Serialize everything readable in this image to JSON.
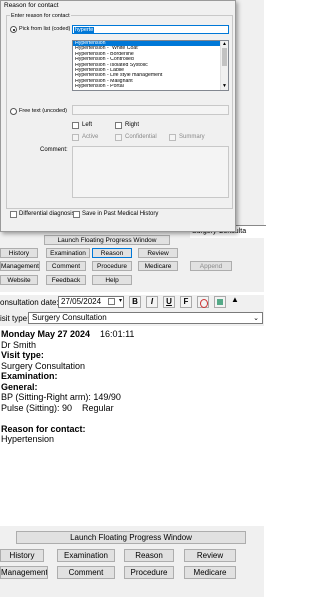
{
  "dialog": {
    "title": "Reason for contact",
    "group_label": "Enter reason for contact",
    "pick_label": "Pick from list (coded)",
    "search_value": "hyperte",
    "list_items": [
      "Hypertension",
      "Hypertension - \"White Coat\"",
      "Hypertension - Borderline",
      "Hypertension - Controlled",
      "Hypertension - Isolated Systolic",
      "Hypertension - Labile",
      "Hypertension - Life style management",
      "Hypertension - Malignant",
      "Hypertension - Portal"
    ],
    "free_text_label": "Free text (uncoded)",
    "left_label": "Left",
    "right_label": "Right",
    "active_label": "Active",
    "confidential_label": "Confidential",
    "summary_label": "Summary",
    "comment_label": "Comment:",
    "differential_label": "Differential diagnosis",
    "save_past_label": "Save in Past Medical History"
  },
  "background_top": {
    "launch_label": "Launch Floating Progress Window",
    "buttons_row1": [
      "History",
      "Examination",
      "Reason",
      "Review"
    ],
    "buttons_row2": [
      "Management",
      "Comment",
      "Procedure",
      "Medicare",
      "Append"
    ],
    "buttons_row3": [
      "Website",
      "Feedback",
      "Help"
    ],
    "visit_type_snippet": "Surgery Consulta"
  },
  "consult": {
    "date_label": "onsultation date:",
    "date_value": "27/05/2024",
    "visit_type_label": "isit type:",
    "visit_type_value": "Surgery Consultation",
    "toolbar": [
      "B",
      "I",
      "U",
      "F"
    ],
    "note_lines": [
      {
        "text": "Monday May 27 2024",
        "extra": "16:01:11",
        "bold": true
      },
      {
        "text": "Dr Smith",
        "bold": false
      },
      {
        "text": "Visit type:",
        "bold": true
      },
      {
        "text": "Surgery Consultation",
        "bold": false
      },
      {
        "text": "Examination:",
        "bold": true
      },
      {
        "text": "General:",
        "bold": true
      },
      {
        "text": "BP (Sitting-Right arm): 149/90",
        "bold": false
      },
      {
        "text": "Pulse (Sitting): 90",
        "extra": "Regular",
        "bold": false
      },
      {
        "text": "",
        "bold": false
      },
      {
        "text": "Reason for contact:",
        "bold": true
      },
      {
        "text": "Hypertension",
        "bold": false
      }
    ]
  },
  "bottom": {
    "launch_label": "Launch Floating Progress Window",
    "row1": [
      "History",
      "Examination",
      "Reason",
      "Review"
    ],
    "row2": [
      "Management",
      "Comment",
      "Procedure",
      "Medicare"
    ]
  },
  "colors": {
    "selection": "#0078d7",
    "dialog_bg": "#f0f0f0"
  }
}
